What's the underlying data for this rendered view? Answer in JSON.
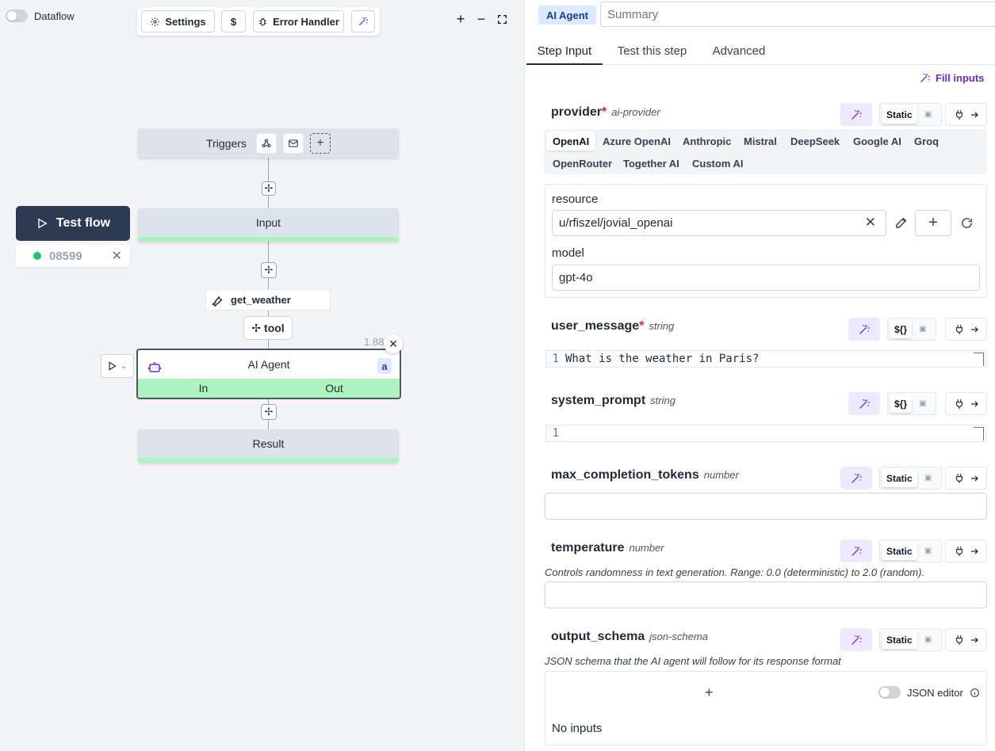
{
  "canvas": {
    "dataflow_label": "Dataflow",
    "toolbar": {
      "settings_label": "Settings",
      "dollar_label": "$",
      "error_handler_label": "Error Handler"
    },
    "test_flow": {
      "label": "Test flow",
      "job_id": "08599",
      "status_color": "#22c55e"
    },
    "nodes": {
      "triggers_label": "Triggers",
      "input_label": "Input",
      "tool_chip_label": "get_weather",
      "tool_button_label": "tool",
      "ai_agent_label": "AI Agent",
      "ai_agent_badge": "a",
      "ai_agent_in": "In",
      "ai_agent_out": "Out",
      "ai_agent_duration": "1.88s",
      "result_label": "Result"
    }
  },
  "panel": {
    "badge": "AI Agent",
    "summary_placeholder": "Summary",
    "tabs": [
      "Step Input",
      "Test this step",
      "Advanced"
    ],
    "active_tab": "Step Input",
    "fill_inputs_label": "Fill inputs",
    "accent_color": "#6d28d9",
    "provider": {
      "name": "provider",
      "required": "*",
      "type": "ai-provider",
      "mode": "Static",
      "options_row1": [
        "OpenAI",
        "Azure OpenAI",
        "Anthropic",
        "Mistral",
        "DeepSeek",
        "Google AI",
        "Groq"
      ],
      "options_row2": [
        "OpenRouter",
        "Together AI",
        "Custom AI"
      ],
      "selected": "OpenAI",
      "resource_label": "resource",
      "resource_value": "u/rfiszel/jovial_openai",
      "model_label": "model",
      "model_value": "gpt-4o"
    },
    "user_message": {
      "name": "user_message",
      "required": "*",
      "type": "string",
      "mode": "${}",
      "line": "1",
      "value": "What is the weather in Paris?"
    },
    "system_prompt": {
      "name": "system_prompt",
      "type": "string",
      "mode": "${}",
      "line": "1",
      "value": ""
    },
    "max_completion_tokens": {
      "name": "max_completion_tokens",
      "type": "number",
      "mode": "Static",
      "value": ""
    },
    "temperature": {
      "name": "temperature",
      "type": "number",
      "mode": "Static",
      "description": "Controls randomness in text generation. Range: 0.0 (deterministic) to 2.0 (random).",
      "value": ""
    },
    "output_schema": {
      "name": "output_schema",
      "type": "json-schema",
      "mode": "Static",
      "description": "JSON schema that the AI agent will follow for its response format",
      "add_symbol": "+",
      "json_editor_label": "JSON editor",
      "empty_label": "No inputs"
    }
  }
}
